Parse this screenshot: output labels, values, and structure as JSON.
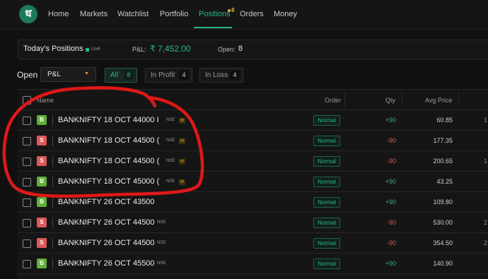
{
  "nav": {
    "logo": "ध",
    "items": [
      {
        "label": "Home"
      },
      {
        "label": "Markets"
      },
      {
        "label": "Watchlist"
      },
      {
        "label": "Portfolio"
      },
      {
        "label": "Positions",
        "active": true
      },
      {
        "label": "Orders"
      },
      {
        "label": "Money"
      }
    ],
    "positions_badge": "8"
  },
  "summary": {
    "title": "Today's Positions",
    "live": "Live",
    "pnl_label": "P&L:",
    "pnl_value": "₹ 7,452.00",
    "open_label": "Open:",
    "open_value": "8"
  },
  "filters": {
    "open_label": "Open",
    "select_value": "P&L",
    "pills": [
      {
        "label": "All",
        "count": "8",
        "active": true
      },
      {
        "label": "In Profit",
        "count": "4"
      },
      {
        "label": "In Loss",
        "count": "4"
      }
    ]
  },
  "table": {
    "headers": {
      "name": "Name",
      "order": "Order",
      "qty": "Qty",
      "avg": "Avg Price"
    },
    "rows": [
      {
        "side": "B",
        "instrument": "BANKNIFTY 18 OCT 44000 I",
        "exchange": "NSE",
        "weekly": "W",
        "order": "Normal",
        "qty": "+90",
        "avg": "60.85",
        "edge": "1"
      },
      {
        "side": "S",
        "instrument": "BANKNIFTY 18 OCT 44500 (",
        "exchange": "NSE",
        "weekly": "W",
        "order": "Normal",
        "qty": "-90",
        "avg": "177.35",
        "edge": ""
      },
      {
        "side": "S",
        "instrument": "BANKNIFTY 18 OCT 44500 (",
        "exchange": "NSE",
        "weekly": "W",
        "order": "Normal",
        "qty": "-90",
        "avg": "200.65",
        "edge": "1"
      },
      {
        "side": "B",
        "instrument": "BANKNIFTY 18 OCT 45000 (",
        "exchange": "NSE",
        "weekly": "W",
        "order": "Normal",
        "qty": "+90",
        "avg": "43.25",
        "edge": ""
      },
      {
        "side": "B",
        "instrument": "BANKNIFTY 26 OCT 43500",
        "exchange": "",
        "weekly": "",
        "order": "Normal",
        "qty": "+90",
        "avg": "109.80",
        "edge": ""
      },
      {
        "side": "S",
        "instrument": "BANKNIFTY 26 OCT 44500",
        "exchange": "NSE",
        "weekly": "",
        "order": "Normal",
        "qty": "-90",
        "avg": "530.00",
        "edge": "2"
      },
      {
        "side": "S",
        "instrument": "BANKNIFTY 26 OCT 44500",
        "exchange": "NSE",
        "weekly": "",
        "order": "Normal",
        "qty": "-90",
        "avg": "354.50",
        "edge": "2"
      },
      {
        "side": "B",
        "instrument": "BANKNIFTY 26 OCT 45500",
        "exchange": "NSE",
        "weekly": "",
        "order": "Normal",
        "qty": "+90",
        "avg": "140.90",
        "edge": ""
      }
    ]
  },
  "colors": {
    "accent": "#2bb58a",
    "buy": "#5fb13a",
    "sell": "#e05858",
    "annotation": "#e01818"
  }
}
